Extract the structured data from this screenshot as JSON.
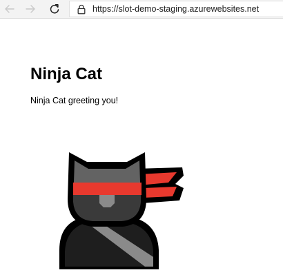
{
  "browser": {
    "url": "https://slot-demo-staging.azurewebsites.net",
    "icons": {
      "back": "arrow-left-icon",
      "forward": "arrow-right-icon",
      "refresh": "refresh-icon",
      "lock": "lock-icon"
    }
  },
  "page": {
    "title": "Ninja Cat",
    "greeting": "Ninja Cat greeting you!",
    "image": "ninja-cat"
  },
  "colors": {
    "headband": "#e8392e",
    "outline": "#000000",
    "fur": "#636363",
    "mask": "#3a3a3a",
    "body": "#1e1e1e",
    "sash": "#8a8a8a",
    "toolbar": "#f3f3f3"
  }
}
